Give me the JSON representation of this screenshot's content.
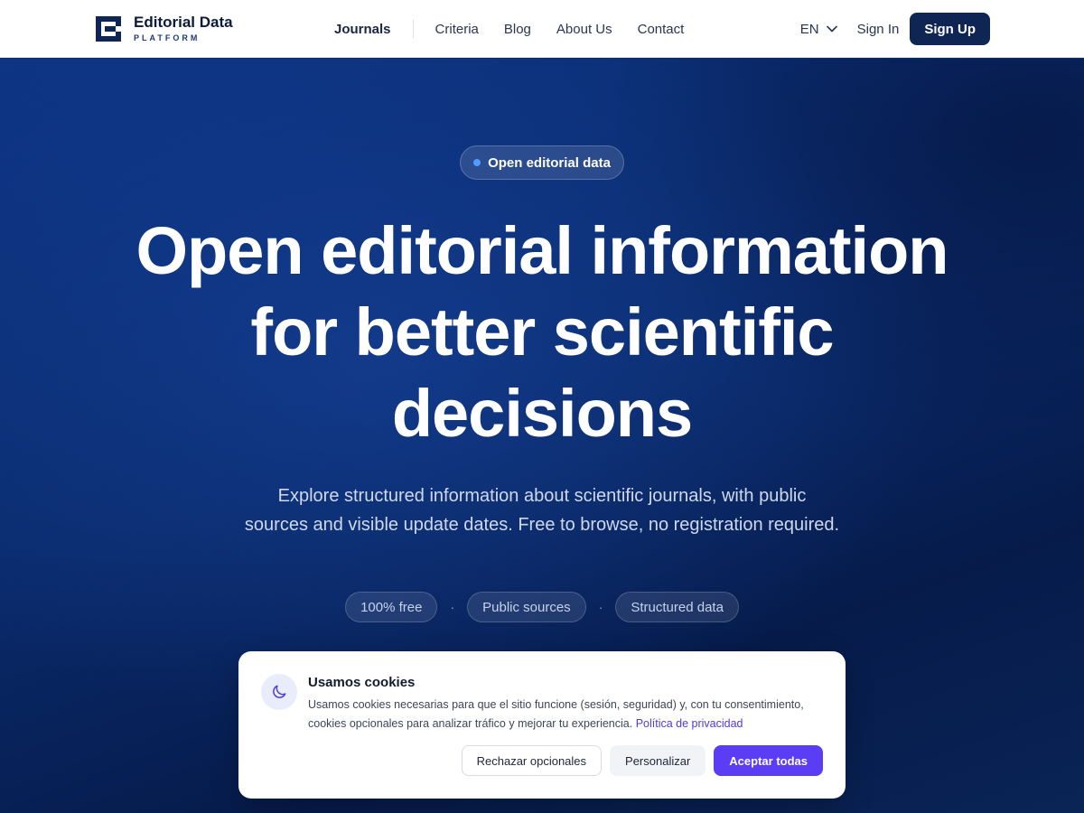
{
  "brand": {
    "name": "Editorial Data",
    "tagline": "PLATFORM"
  },
  "nav": {
    "items": [
      {
        "label": "Journals",
        "active": true
      },
      {
        "label": "Criteria"
      },
      {
        "label": "Blog"
      },
      {
        "label": "About Us"
      },
      {
        "label": "Contact"
      }
    ]
  },
  "header": {
    "language": "EN",
    "sign_in": "Sign In",
    "sign_up": "Sign Up"
  },
  "hero": {
    "badge": "Open editorial data",
    "headline_line1": "Open editorial information",
    "headline_line2": "for better scientific",
    "headline_line3": "decisions",
    "subtext": "Explore structured information about scientific journals, with public sources and visible update dates. Free to browse, no registration required.",
    "tags": [
      "100% free",
      "Public sources",
      "Structured data"
    ],
    "tag_separator": "·"
  },
  "cookie": {
    "title": "Usamos cookies",
    "text": "Usamos cookies necesarias para que el sitio funcione (sesión, seguridad) y, con tu consentimiento, cookies opcionales para analizar tráfico y mejorar tu experiencia. ",
    "link": "Política de privacidad",
    "reject": "Rechazar opcionales",
    "customize": "Personalizar",
    "accept": "Aceptar todas"
  },
  "colors": {
    "brand_navy": "#0f2654",
    "accent_purple": "#5b3df5",
    "badge_dot": "#4f9bff"
  },
  "icons": {
    "logo": "logo-e-icon",
    "language": "chevron-down-icon",
    "cookie": "moon-icon"
  }
}
